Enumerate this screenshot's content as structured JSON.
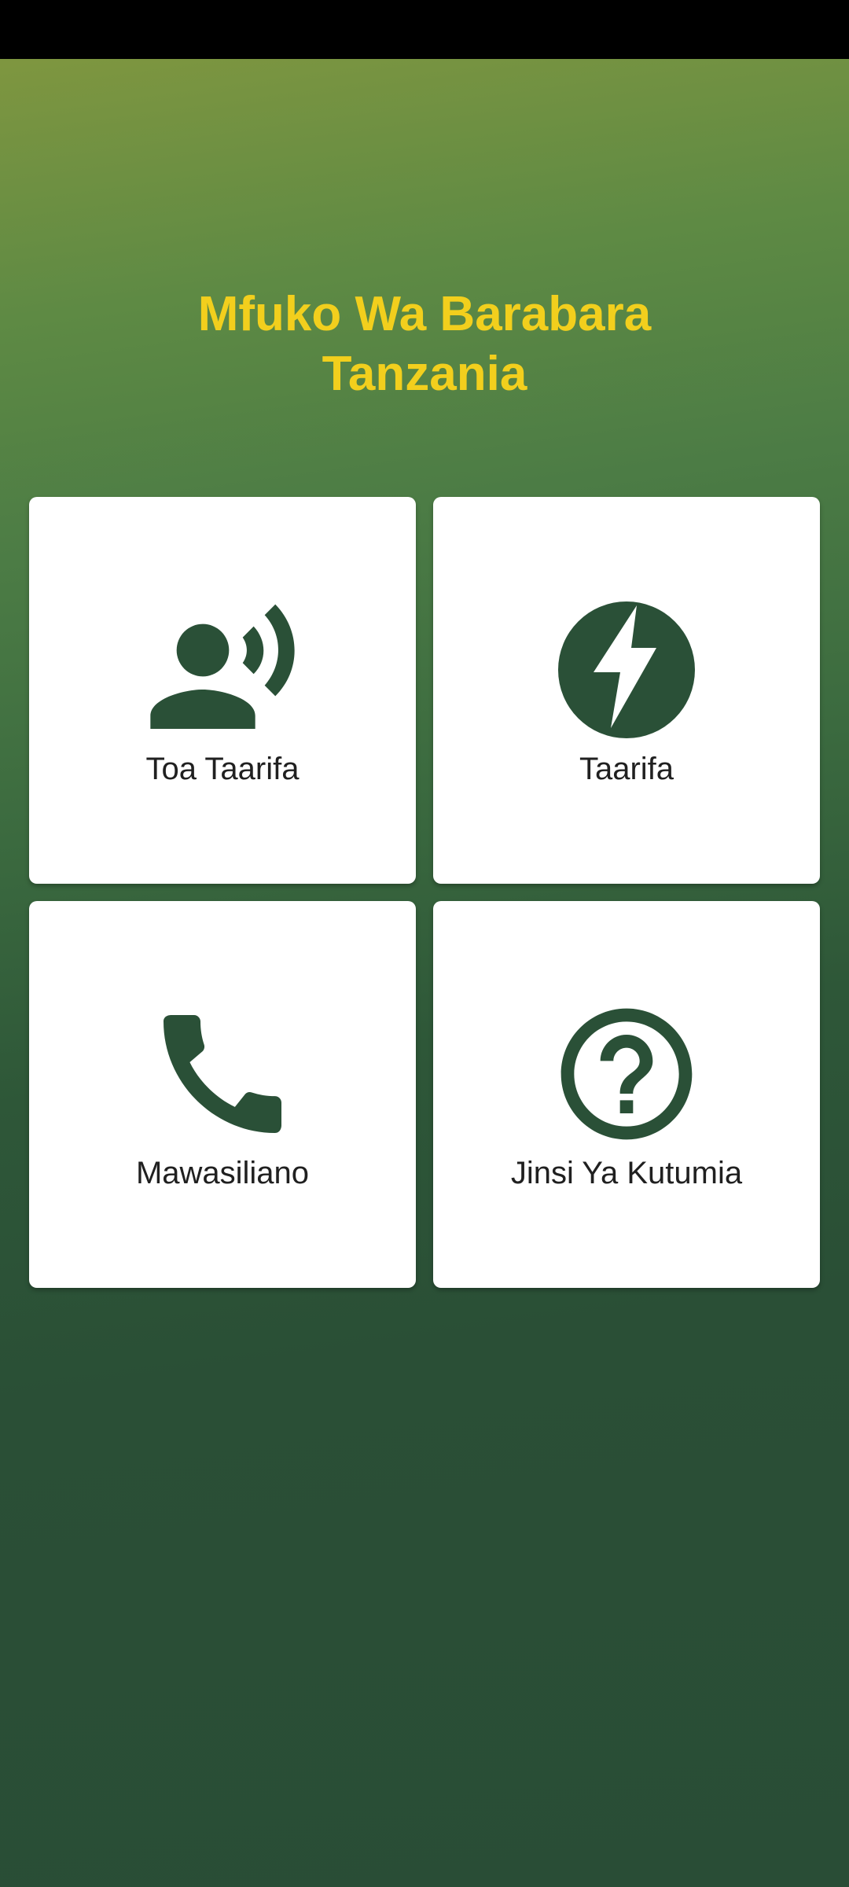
{
  "app": {
    "title_line1": "Mfuko Wa Barabara",
    "title_line2": "Tanzania"
  },
  "colors": {
    "title": "#f2cf1d",
    "icon": "#2a5037",
    "tile_background": "#ffffff",
    "label": "#202020"
  },
  "menu": {
    "items": [
      {
        "label": "Toa Taarifa",
        "icon": "record-voice-icon"
      },
      {
        "label": "Taarifa",
        "icon": "lightning-bolt-icon"
      },
      {
        "label": "Mawasiliano",
        "icon": "phone-icon"
      },
      {
        "label": "Jinsi Ya Kutumia",
        "icon": "help-circle-icon"
      }
    ]
  }
}
